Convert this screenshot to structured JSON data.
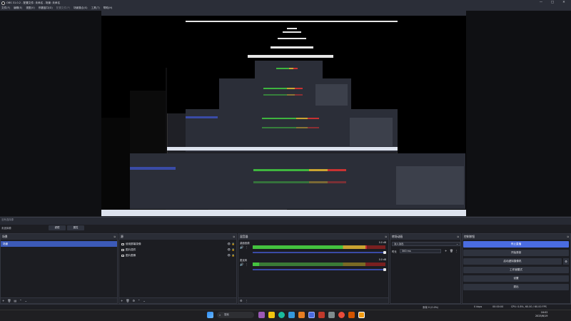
{
  "window": {
    "title": "OBS 31.0.2 - 配置文件: 未命名 - 场景: 未命名",
    "controls": [
      "minimize-icon",
      "maximize-icon",
      "close-icon"
    ]
  },
  "menu": [
    "文件(F)",
    "编辑(E)",
    "视图(V)",
    "停靠窗口(D)",
    "配置文件(P)",
    "场景集合(S)",
    "工具(T)",
    "帮助(H)"
  ],
  "context_bar": {
    "no_source": "没有选择源",
    "label": "未选择源",
    "filters": "滤镜",
    "properties": "属性"
  },
  "scenes": {
    "title": "场景",
    "items": [
      {
        "label": "场景",
        "selected": true
      }
    ]
  },
  "sources": {
    "title": "源",
    "items": [
      {
        "label": "使用屏幕录像"
      },
      {
        "label": "图片插件"
      },
      {
        "label": "图片图像"
      }
    ]
  },
  "mixer": {
    "title": "混音器",
    "channels": [
      {
        "name": "桌面音频",
        "db": "0.0 dB",
        "level": 0.86
      },
      {
        "name": "麦克风",
        "db": "0.0 dB",
        "level": 0.05
      }
    ]
  },
  "transitions": {
    "title": "转场动画",
    "type": "淡入淡出",
    "duration_label": "时长",
    "duration": "300 ms"
  },
  "controls": {
    "title": "控制按钮",
    "buttons": [
      {
        "label": "停止直播",
        "highlighted": true
      },
      {
        "label": "开始录制",
        "highlighted": false
      },
      {
        "label": "启动虚拟摄像机",
        "highlighted": false
      },
      {
        "label": "工作室模式",
        "highlighted": false
      },
      {
        "label": "设置",
        "highlighted": false
      },
      {
        "label": "退出",
        "highlighted": false
      }
    ]
  },
  "status": {
    "dropped": "丢帧 0 (0.0%)",
    "bitrate": "0 kbps",
    "stream_time": "00:00:00",
    "rec_time": "00:00:00",
    "cpu": "CPU: 0.8%, 60.00 / 60.00 FPS"
  },
  "taskbar": {
    "search_placeholder": "搜索",
    "time": "16:02",
    "date": "2025/6/19",
    "apps": [
      "start-icon",
      "search-icon",
      "chat-app-icon",
      "folder-icon",
      "edge-icon",
      "store-icon",
      "paint-icon",
      "obs-icon",
      "browser-icon",
      "settings-icon",
      "game-icon",
      "recorder-icon"
    ]
  },
  "colors": {
    "accent": "#3c5ab8",
    "button_highlight": "#4a6ce0",
    "meter_green": "#44c33f",
    "meter_yellow": "#caa431",
    "meter_red": "#c83232"
  }
}
